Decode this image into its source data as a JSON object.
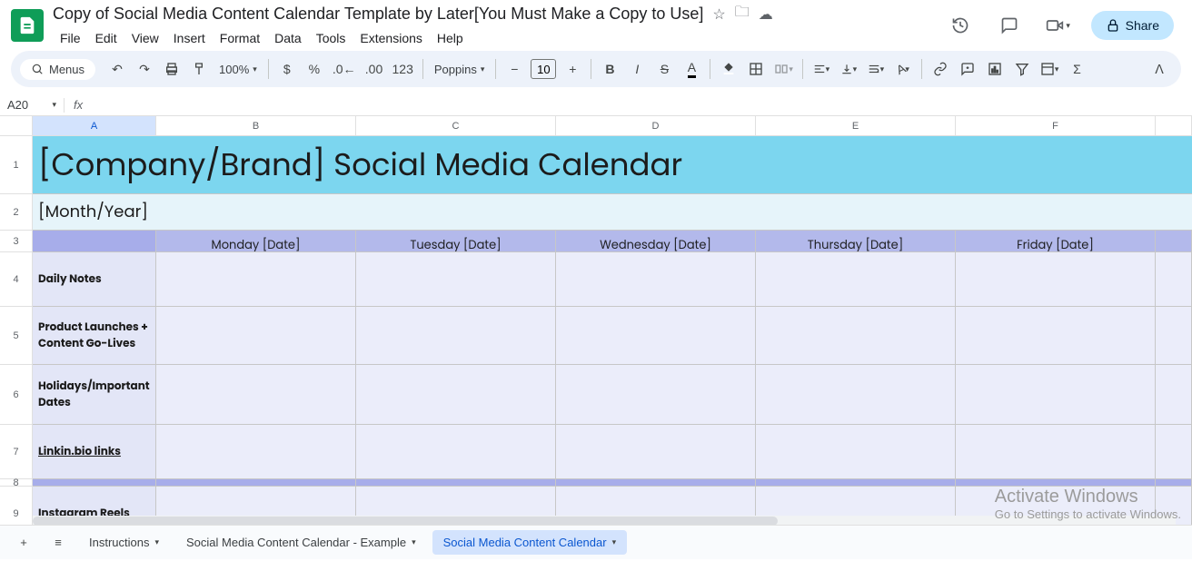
{
  "doc": {
    "title": "Copy of Social Media Content Calendar Template by Later[You Must Make a Copy to Use]"
  },
  "menus": [
    "File",
    "Edit",
    "View",
    "Insert",
    "Format",
    "Data",
    "Tools",
    "Extensions",
    "Help"
  ],
  "toolbar": {
    "menus_label": "Menus",
    "zoom": "100%",
    "font": "Poppins",
    "fontsize": "10",
    "share": "Share"
  },
  "namebox": "A20",
  "cols": [
    "A",
    "B",
    "C",
    "D",
    "E",
    "F"
  ],
  "sheet": {
    "title": "[Company/Brand] Social Media Calendar",
    "subtitle": "[Month/Year]",
    "day_headers": [
      "Monday [Date]",
      "Tuesday [Date]",
      "Wednesday [Date]",
      "Thursday [Date]",
      "Friday [Date]"
    ],
    "rows": [
      {
        "label": "Daily Notes"
      },
      {
        "label": "Product Launches + Content Go-Lives"
      },
      {
        "label": "Holidays/Important Dates"
      },
      {
        "label": "Linkin.bio links",
        "link": true
      },
      {
        "label": "Instagram Reels"
      }
    ]
  },
  "tabs": {
    "items": [
      {
        "label": "Instructions"
      },
      {
        "label": "Social Media Content Calendar - Example"
      },
      {
        "label": "Social Media Content Calendar",
        "active": true
      }
    ]
  },
  "watermark": {
    "l1": "Activate Windows",
    "l2": "Go to Settings to activate Windows."
  }
}
